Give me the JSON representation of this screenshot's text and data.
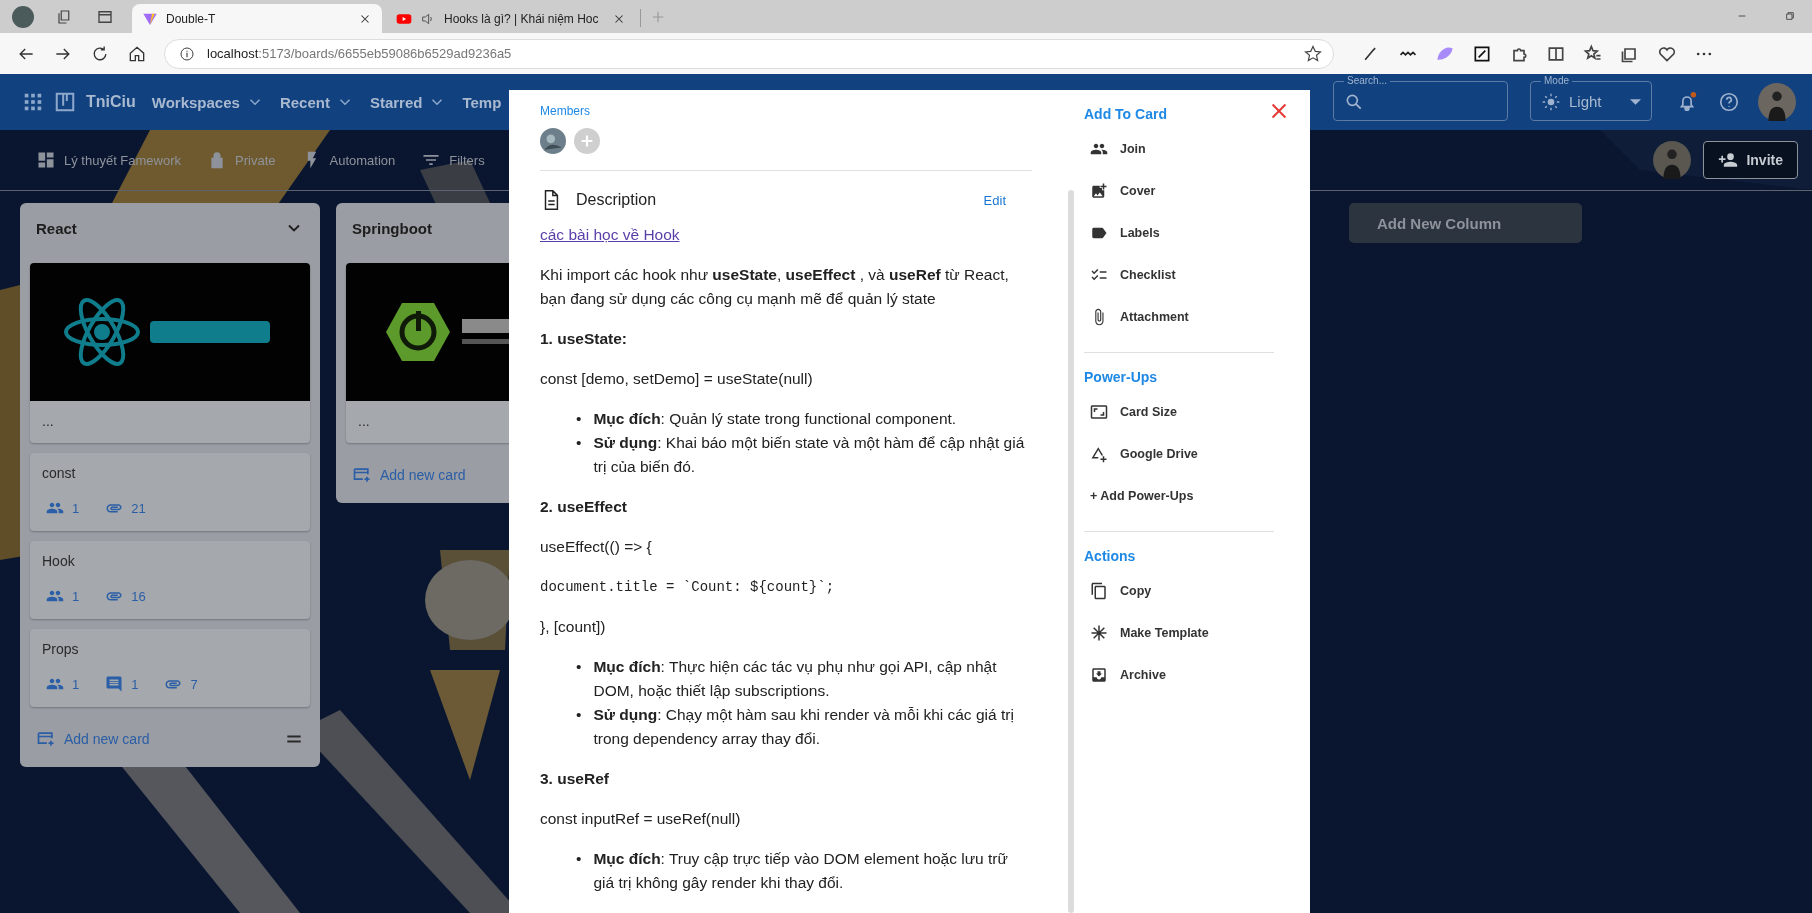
{
  "browser": {
    "tabs": [
      {
        "title": "Double-T",
        "selected": true,
        "kind": "app"
      },
      {
        "title": "Hooks là gì? | Khái niệm Hoc",
        "selected": false,
        "kind": "video"
      }
    ],
    "url_host": "localhost",
    "url_rest": ":5173/boards/6655eb59086b6529ad9236a5"
  },
  "app_bar": {
    "brand": "TniCiu",
    "menus": [
      {
        "label": "Workspaces",
        "dropdown": true
      },
      {
        "label": "Recent",
        "dropdown": true
      },
      {
        "label": "Starred",
        "dropdown": true
      },
      {
        "label": "Temp",
        "dropdown": false
      }
    ],
    "search_label": "Search...",
    "mode_label": "Mode",
    "mode_value": "Light",
    "has_unread": true
  },
  "board_bar": {
    "title": "Lý thuyết Famework",
    "visibility": "Private",
    "tools": [
      {
        "label": "Automation",
        "kind": "bolt"
      },
      {
        "label": "Filters",
        "kind": "filter"
      }
    ],
    "invite": "Invite"
  },
  "columns": [
    {
      "title": "React",
      "collapsible": true,
      "cards": [
        {
          "title": "...",
          "kind": "picture"
        },
        {
          "title": "const",
          "badges": [
            {
              "kind": "members",
              "count": "1"
            },
            {
              "kind": "attachments",
              "count": "21"
            }
          ]
        },
        {
          "title": "Hook",
          "badges": [
            {
              "kind": "members",
              "count": "1"
            },
            {
              "kind": "attachments",
              "count": "16"
            }
          ]
        },
        {
          "title": "Props",
          "badges": [
            {
              "kind": "members",
              "count": "1"
            },
            {
              "kind": "comments",
              "count": "1"
            },
            {
              "kind": "attachments",
              "count": "7"
            }
          ]
        }
      ],
      "add_card": "Add new card",
      "drag_handle": true
    },
    {
      "title": "Springboot",
      "collapsible": false,
      "cards": [
        {
          "title": "...",
          "kind": "picture"
        }
      ],
      "add_card": "Add new card",
      "drag_handle": false
    }
  ],
  "add_column": "Add New Column",
  "modal": {
    "members_label": "Members",
    "description_heading": "Description",
    "edit": "Edit",
    "link": "các bài học về Hook",
    "blocks": [
      {
        "kind": "paragraph",
        "text": "Khi import các hook như **useState**, **useEffect** , và **useRef** từ React, bạn đang sử dụng các công cụ mạnh mẽ để quản lý state"
      },
      {
        "kind": "heading",
        "text": "1. useState:"
      },
      {
        "kind": "paragraph",
        "text": "const [demo, setDemo] = useState(null)"
      },
      {
        "kind": "list",
        "marker": "•",
        "items": [
          "**Mục đích**: Quản lý state trong functional component.",
          "**Sử dụng**: Khai báo một biến state và một hàm để cập nhật giá trị của biến đó."
        ]
      },
      {
        "kind": "heading",
        "text": "2. useEffect"
      },
      {
        "kind": "paragraph",
        "text": "useEffect(() => {"
      },
      {
        "kind": "code",
        "text": "document.title = `Count: ${count}`;"
      },
      {
        "kind": "paragraph",
        "text": "}, [count])"
      },
      {
        "kind": "list",
        "marker": "•",
        "items": [
          "**Mục đích**: Thực hiện các tác vụ phụ như gọi API, cập nhật DOM, hoặc thiết lập subscriptions.",
          "**Sử dụng**: Chạy một hàm sau khi render và mỗi khi các giá trị trong dependency array thay đổi."
        ]
      },
      {
        "kind": "heading",
        "text": "3. useRef"
      },
      {
        "kind": "paragraph",
        "text": "const inputRef = useRef(null)"
      },
      {
        "kind": "list",
        "marker": "•",
        "items": [
          "**Mục đích**: Truy cập trực tiếp vào DOM element hoặc lưu trữ giá trị không gây render khi thay đổi."
        ]
      }
    ],
    "sections": [
      {
        "title": "Add To Card",
        "items": [
          {
            "label": "Join",
            "kind": "join"
          },
          {
            "label": "Cover",
            "kind": "cover"
          },
          {
            "label": "Labels",
            "kind": "labels"
          },
          {
            "label": "Checklist",
            "kind": "checklist"
          },
          {
            "label": "Attachment",
            "kind": "attachment"
          }
        ]
      },
      {
        "title": "Power-Ups",
        "items": [
          {
            "label": "Card Size",
            "kind": "size"
          },
          {
            "label": "Google Drive",
            "kind": "drive"
          },
          {
            "label": "+ Add Power-Ups",
            "kind": "add"
          }
        ]
      },
      {
        "title": "Actions",
        "items": [
          {
            "label": "Copy",
            "kind": "copy"
          },
          {
            "label": "Make Template",
            "kind": "template"
          },
          {
            "label": "Archive",
            "kind": "archive"
          }
        ]
      }
    ]
  }
}
